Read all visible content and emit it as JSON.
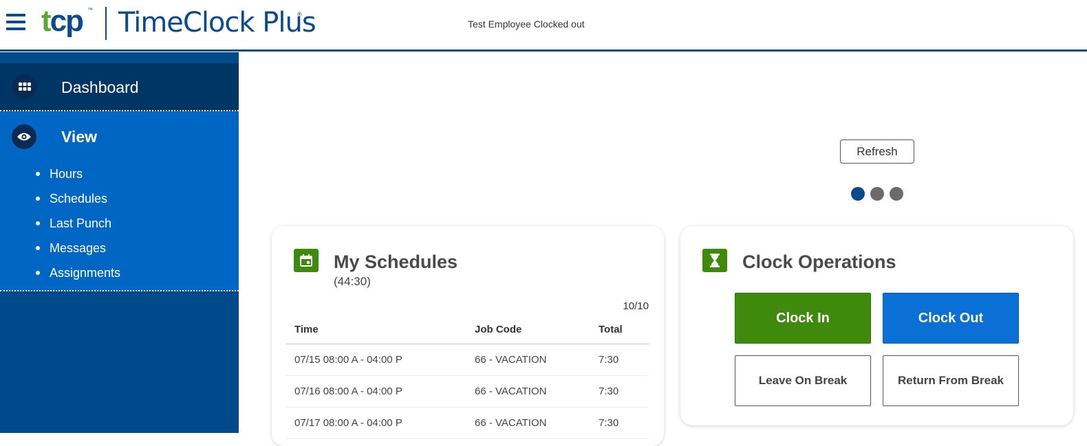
{
  "header": {
    "logo_mark": "tcp",
    "logo_tm": "™",
    "logo_text": "TimeClock Plus",
    "logo_reg": "®",
    "status": "Test Employee Clocked out"
  },
  "sidebar": {
    "dashboard_label": "Dashboard",
    "view_label": "View",
    "view_items": [
      {
        "label": "Hours"
      },
      {
        "label": "Schedules"
      },
      {
        "label": "Last Punch"
      },
      {
        "label": "Messages"
      },
      {
        "label": "Assignments"
      }
    ]
  },
  "main": {
    "refresh_label": "Refresh",
    "carousel": {
      "count": 3,
      "active_index": 0
    }
  },
  "schedules_card": {
    "icon": "calendar-icon",
    "title": "My Schedules",
    "subtitle": "(44:30)",
    "pager": "10/10",
    "columns": [
      "Time",
      "Job Code",
      "Total"
    ],
    "rows": [
      {
        "time": "07/15 08:00 A - 04:00 P",
        "job_code": "66 - VACATION",
        "total": "7:30"
      },
      {
        "time": "07/16 08:00 A - 04:00 P",
        "job_code": "66 - VACATION",
        "total": "7:30"
      },
      {
        "time": "07/17 08:00 A - 04:00 P",
        "job_code": "66 - VACATION",
        "total": "7:30"
      }
    ]
  },
  "clock_card": {
    "icon": "hourglass-icon",
    "title": "Clock Operations",
    "clock_in": "Clock In",
    "clock_out": "Clock Out",
    "leave_break": "Leave On Break",
    "return_break": "Return From Break"
  },
  "colors": {
    "brand_blue": "#0b4a8b",
    "sidebar_dark": "#003665",
    "sidebar_active": "#0066c4",
    "green": "#3f8a0d",
    "clock_out_blue": "#0a70d6"
  }
}
